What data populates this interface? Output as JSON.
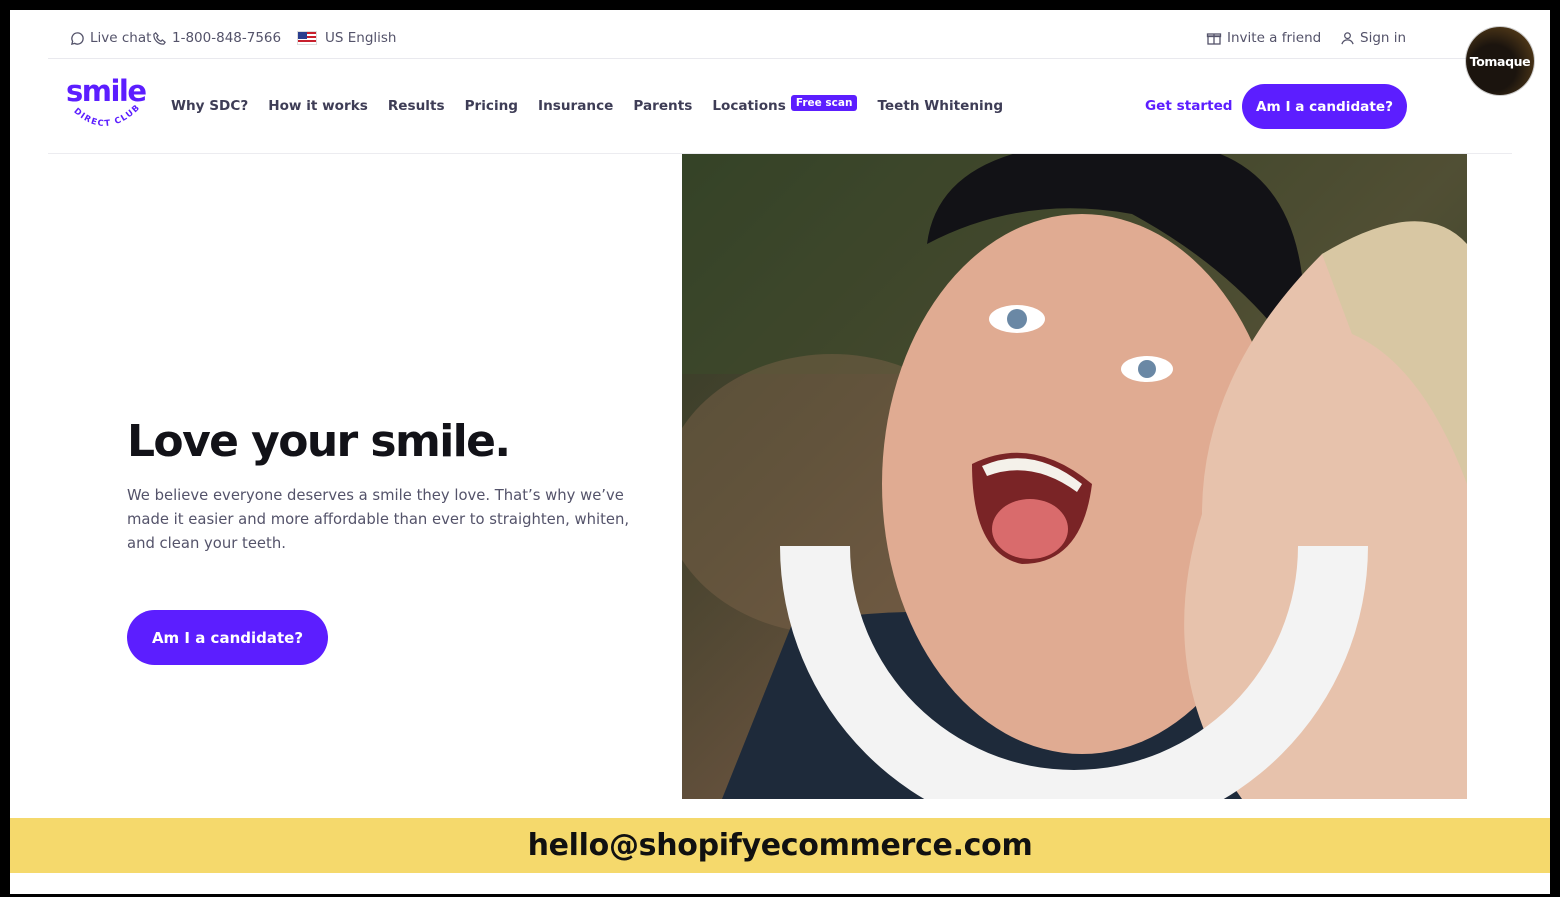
{
  "utility": {
    "live_chat": "Live chat",
    "phone": "1-800-848-7566",
    "language": "US English",
    "invite": "Invite a friend",
    "sign_in": "Sign in"
  },
  "brand": {
    "name": "smile",
    "sub": "DIRECT CLUB",
    "accent": "#5c1eff"
  },
  "nav": {
    "links": [
      "Why SDC?",
      "How it works",
      "Results",
      "Pricing",
      "Insurance",
      "Parents",
      "Locations"
    ],
    "badge": "Free scan",
    "after_badge": "Teeth Whitening",
    "get_started": "Get started",
    "cta": "Am I a candidate?"
  },
  "avatar": {
    "label": "Tomaque"
  },
  "hero": {
    "title": "Love your smile.",
    "copy": "We believe everyone deserves a smile they love. That’s why we’ve made it easier and more affordable than ever to straighten, whiten, and clean your teeth.",
    "cta": "Am I a candidate?"
  },
  "banner": {
    "email": "hello@shopifyecommerce.com",
    "color": "#f5d96c"
  }
}
